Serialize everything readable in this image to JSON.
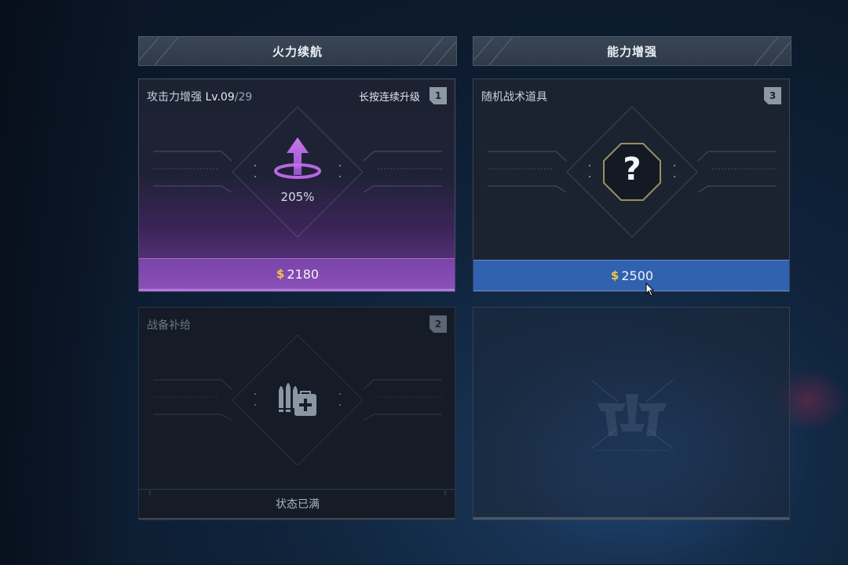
{
  "columns": [
    {
      "title": "火力续航"
    },
    {
      "title": "能力增强"
    }
  ],
  "cards": {
    "attack": {
      "title": "攻击力增强",
      "level_prefix": "Lv.",
      "level": "09",
      "level_max": "/29",
      "hint": "长按连续升级",
      "slot": "1",
      "percent": "205%",
      "price": "2180",
      "icon": "attack-upgrade-arrow-icon",
      "accent_color": "#8a4fb8"
    },
    "random": {
      "title": "随机战术道具",
      "slot": "3",
      "symbol": "?",
      "price": "2500",
      "icon": "question-octagon-icon",
      "accent_color": "#3062b0"
    },
    "supply": {
      "title": "战备补给",
      "slot": "2",
      "status": "状态已满",
      "icon": "ammo-medkit-icon"
    },
    "locked": {
      "icon": "faction-emblem-icon"
    }
  },
  "currency": {
    "symbol": "$",
    "color": "#f2c648"
  }
}
